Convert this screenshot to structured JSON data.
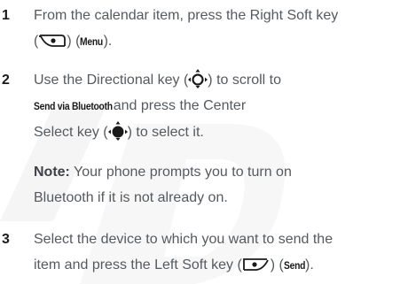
{
  "steps": [
    {
      "number": "1",
      "line1": "From the calendar item, press the Right Soft key",
      "line2_pre": "(",
      "line2_mid": ") (",
      "line2_bold": "Menu",
      "line2_post": ")."
    },
    {
      "number": "2",
      "line1": "Use the Directional key (",
      "line1_post": ") to scroll to",
      "line2_bold": "Send via Bluetooth",
      "line2_post": " and press the Center",
      "line3_pre": "Select key (",
      "line3_post": ") to select it."
    },
    {
      "number": "3",
      "line1": "Select the device to which you want to send the",
      "line2_pre": "item and press the Left Soft key (",
      "line2_mid": ") (",
      "line2_bold": "Send",
      "line2_post": ")."
    }
  ],
  "note": {
    "label": "Note:",
    "line1": " Your phone prompts you to turn on",
    "line2": "Bluetooth if it is not already on."
  },
  "icons": {
    "right_soft_key": "right-soft-key-icon",
    "left_soft_key": "left-soft-key-icon",
    "directional_key": "directional-key-icon",
    "center_select_key": "center-select-key-icon"
  },
  "colors": {
    "body_text": "#555a5f",
    "step_number": "#1a1a1a",
    "watermark": "#f4f4f4"
  }
}
